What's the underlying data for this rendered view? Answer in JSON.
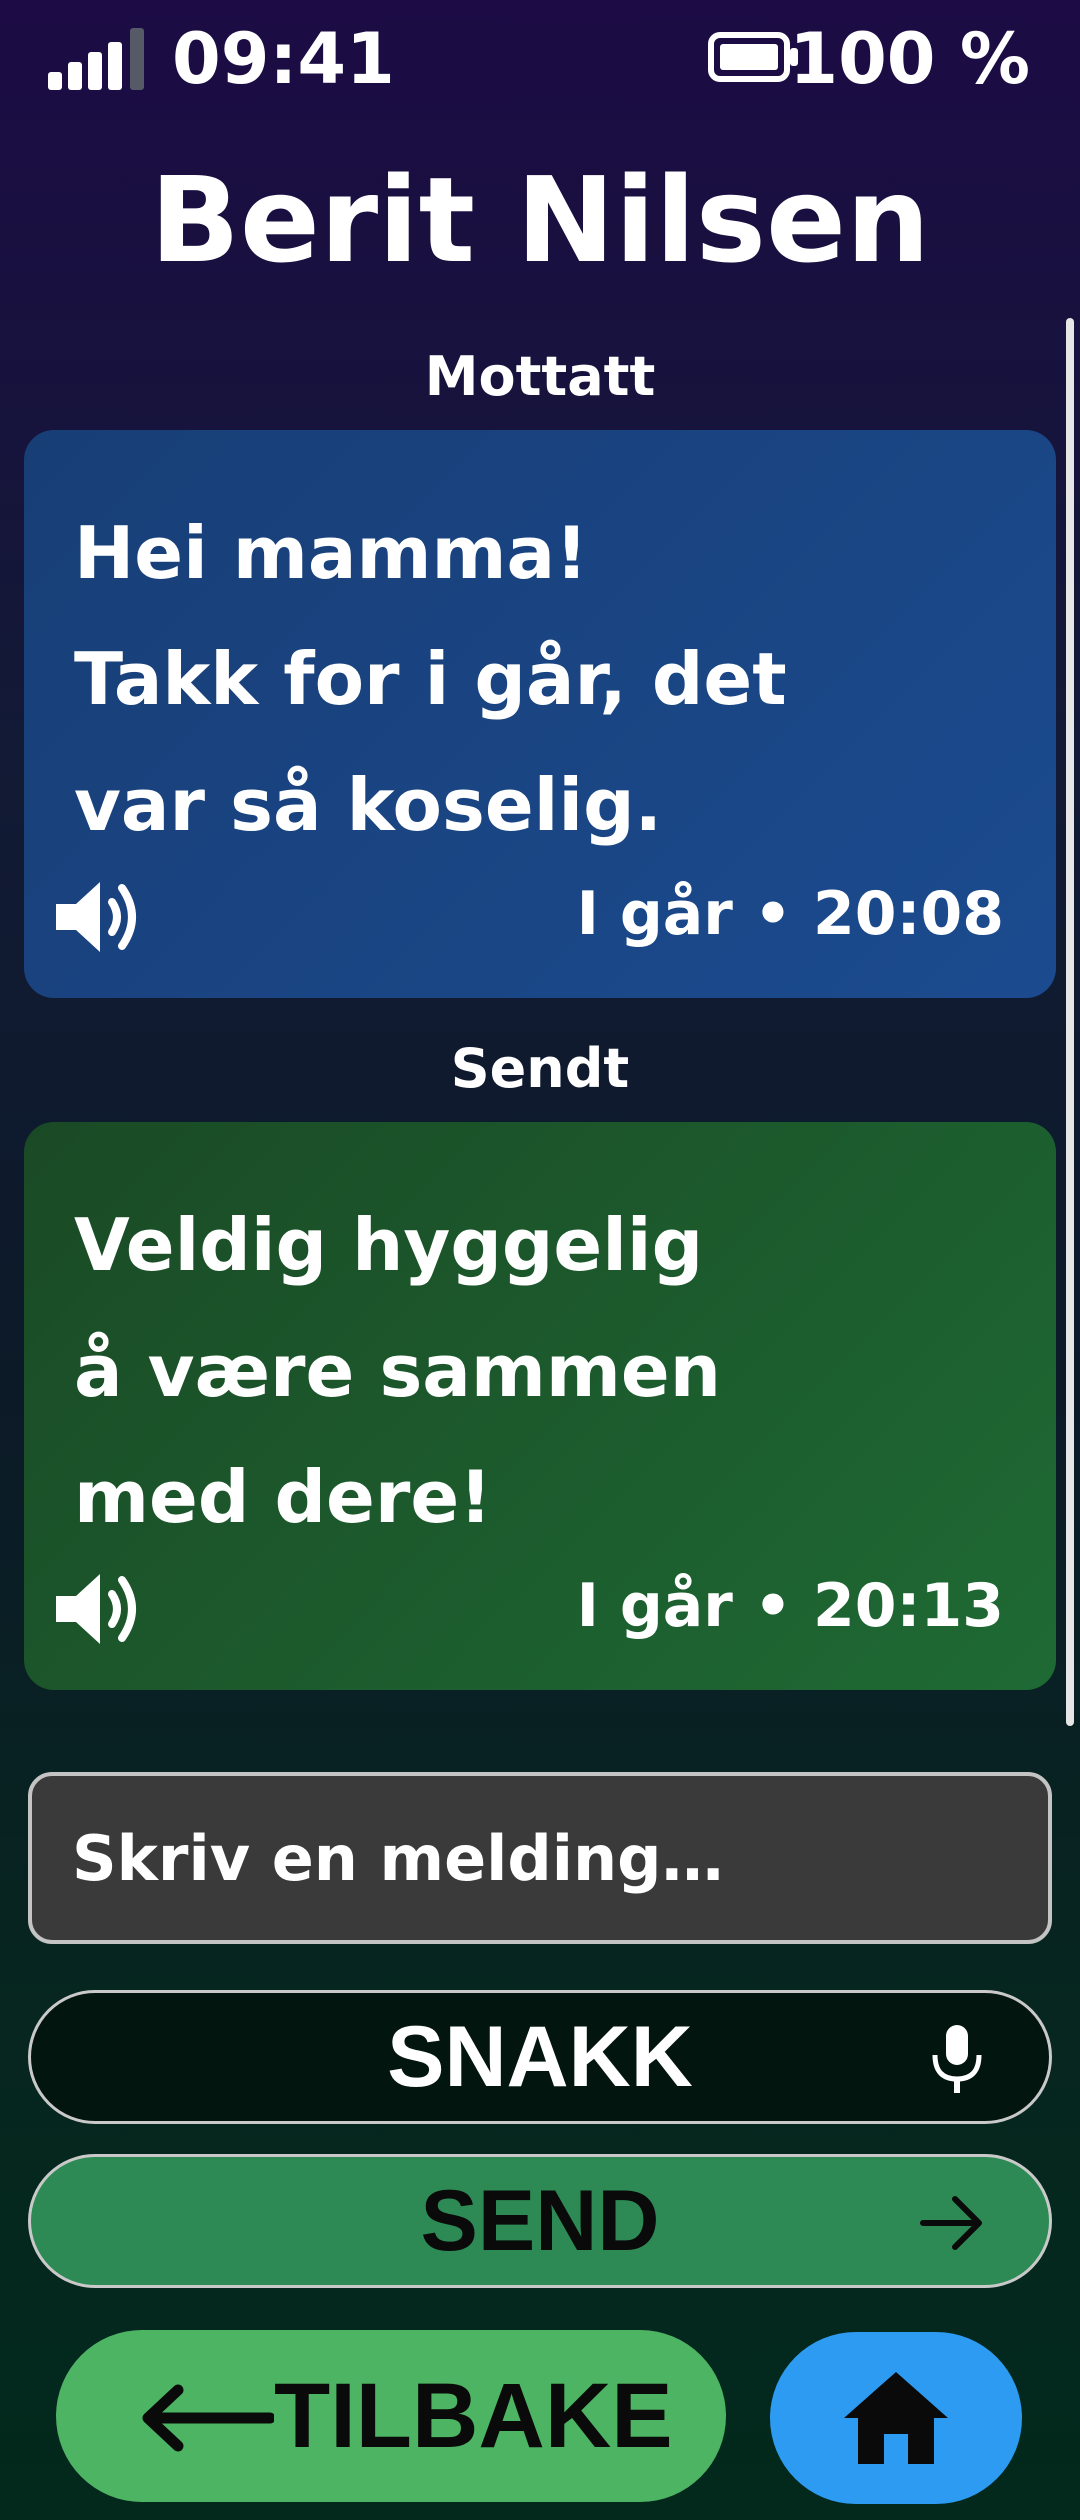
{
  "status_bar": {
    "time": "09:41",
    "battery": "100 %",
    "signal_bars": 5,
    "signal_active": 4
  },
  "contact": {
    "name": "Berit Nilsen"
  },
  "messages": [
    {
      "direction_label": "Mottatt",
      "lines": [
        "Hei mamma!",
        "Takk for i går, det",
        "var så koselig."
      ],
      "time": "I går • 20:08",
      "color": "#1b4a8c"
    },
    {
      "direction_label": "Sendt",
      "lines": [
        "Veldig hyggelig",
        "å være sammen",
        "med dere!"
      ],
      "time": "I går • 20:13",
      "color": "#1e6530"
    }
  ],
  "composer": {
    "placeholder": "Skriv en melding…"
  },
  "buttons": {
    "talk": "SNAKK",
    "send": "SEND",
    "back": "TILBAKE"
  },
  "icons": {
    "signal": "signal-icon",
    "battery": "battery-icon",
    "speaker": "speaker-icon",
    "mic": "mic-icon",
    "send": "arrow-right-icon",
    "back": "arrow-left-icon",
    "home": "home-icon"
  },
  "colors": {
    "send_button": "#2e8a55",
    "back_button": "#4cb462",
    "home_button": "#2e9bf2"
  }
}
